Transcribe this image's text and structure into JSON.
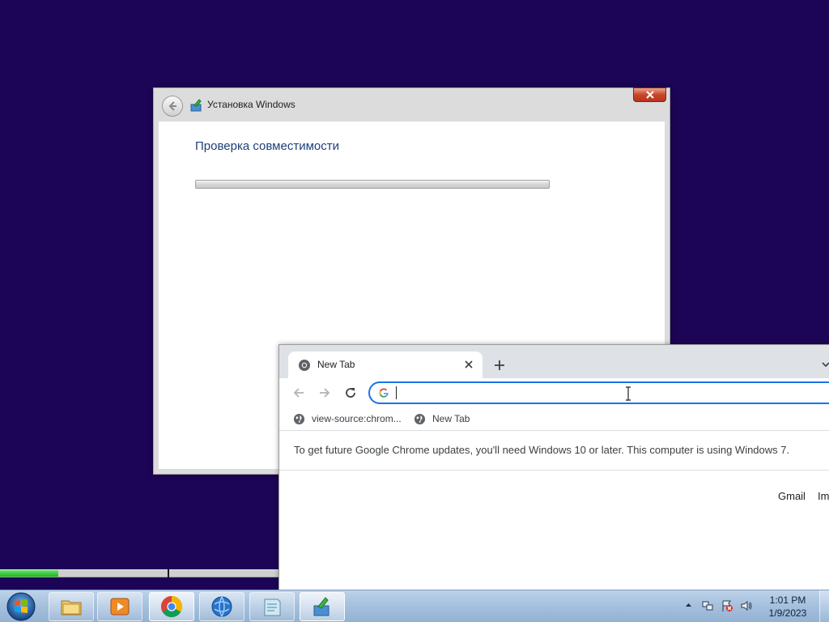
{
  "colors": {
    "desktop_background": "#1c0556",
    "setup_heading": "#1e3f78",
    "chrome_focus": "#1a73e8",
    "install_progress": "#19b519"
  },
  "setup_window": {
    "title": "Установка Windows",
    "heading": "Проверка совместимости",
    "progress_fraction": 0.0,
    "icons": {
      "back": "back-arrow-icon",
      "app": "windows-setup-icon",
      "close": "close-icon"
    }
  },
  "install_strip": {
    "progress_fraction": 0.21,
    "marker_fraction": 0.6
  },
  "chrome": {
    "tab": {
      "title": "New Tab",
      "icon": "chrome-icon"
    },
    "omnibox": {
      "value": "",
      "placeholder": ""
    },
    "bookmarks": [
      {
        "label": "view-source:chrom...",
        "icon": "globe-icon"
      },
      {
        "label": "New Tab",
        "icon": "globe-icon"
      }
    ],
    "infobar_text": "To get future Google Chrome updates, you'll need Windows 10 or later. This computer is using Windows 7.",
    "page_links": {
      "gmail": "Gmail",
      "images": "Im"
    }
  },
  "taskbar": {
    "buttons": [
      {
        "name": "explorer",
        "icon": "folder-icon"
      },
      {
        "name": "media-player",
        "icon": "media-player-icon"
      },
      {
        "name": "chrome",
        "icon": "chrome-icon"
      },
      {
        "name": "internet-explorer",
        "icon": "internet-explorer-icon"
      },
      {
        "name": "notepad",
        "icon": "notepad-icon"
      },
      {
        "name": "windows-setup",
        "icon": "windows-setup-icon"
      }
    ],
    "clock": {
      "time": "1:01 PM",
      "date": "1/9/2023"
    }
  }
}
